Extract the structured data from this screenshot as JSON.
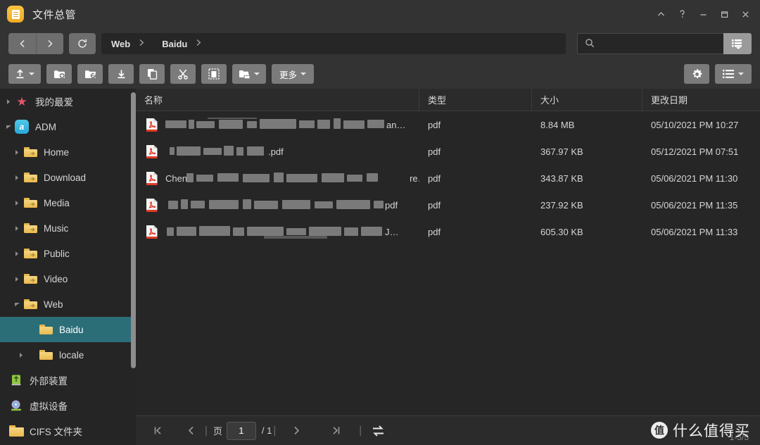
{
  "window": {
    "app_icon": "document-app-icon",
    "title": "文件总管",
    "controls": [
      {
        "name": "collapse-ribbon-button",
        "glyph": "chevron-up-icon"
      },
      {
        "name": "help-button",
        "glyph": "question-mark-icon"
      },
      {
        "name": "minimize-button",
        "glyph": "minimize-icon"
      },
      {
        "name": "maximize-button",
        "glyph": "maximize-icon"
      },
      {
        "name": "close-button",
        "glyph": "close-icon"
      }
    ]
  },
  "navbar": {
    "back_icon": "chevron-left-icon",
    "forward_icon": "chevron-right-icon",
    "refresh_icon": "refresh-icon",
    "breadcrumb": [
      "Web",
      "Baidu"
    ],
    "search": {
      "value": "",
      "placeholder": ""
    },
    "filter_icon": "list-filter-icon"
  },
  "toolbar": {
    "buttons": [
      {
        "name": "upload-button",
        "icon": "upload-icon",
        "label": "",
        "caret": true
      },
      {
        "name": "new-folder-button",
        "icon": "folder-plus-icon",
        "label": "",
        "caret": false
      },
      {
        "name": "new-shared-folder-button",
        "icon": "folder-share-icon",
        "label": "",
        "caret": false
      },
      {
        "name": "download-button",
        "icon": "download-icon",
        "label": "",
        "caret": false
      },
      {
        "name": "copy-button",
        "icon": "copy-icon",
        "label": "",
        "caret": false
      },
      {
        "name": "cut-button",
        "icon": "scissors-icon",
        "label": "",
        "caret": false
      },
      {
        "name": "paste-button",
        "icon": "paste-icon",
        "label": "",
        "caret": false
      },
      {
        "name": "share-button",
        "icon": "network-folder-icon",
        "label": "",
        "caret": true
      },
      {
        "name": "more-button",
        "icon": "",
        "label": "更多",
        "caret": true
      }
    ],
    "settings_icon": "gear-icon",
    "view_mode_icon": "list-view-icon",
    "view_mode_caret": true
  },
  "sidebar": {
    "items": [
      {
        "label": "我的最爱",
        "icon": "star-icon",
        "arrow": "collapsed",
        "indent": 0,
        "selected": false
      },
      {
        "label": "ADM",
        "icon": "adm-icon",
        "arrow": "expanded",
        "indent": 0,
        "selected": false
      },
      {
        "label": "Home",
        "icon": "folder-icon",
        "arrow": "collapsed",
        "indent": 1,
        "selected": false
      },
      {
        "label": "Download",
        "icon": "folder-icon",
        "arrow": "collapsed",
        "indent": 1,
        "selected": false
      },
      {
        "label": "Media",
        "icon": "folder-icon",
        "arrow": "collapsed",
        "indent": 1,
        "selected": false
      },
      {
        "label": "Music",
        "icon": "folder-icon",
        "arrow": "collapsed",
        "indent": 1,
        "selected": false
      },
      {
        "label": "Public",
        "icon": "folder-icon",
        "arrow": "collapsed",
        "indent": 1,
        "selected": false
      },
      {
        "label": "Video",
        "icon": "folder-icon",
        "arrow": "collapsed",
        "indent": 1,
        "selected": false
      },
      {
        "label": "Web",
        "icon": "folder-icon",
        "arrow": "expanded",
        "indent": 1,
        "selected": false
      },
      {
        "label": "Baidu",
        "icon": "folder-icon",
        "arrow": "none",
        "indent": 2,
        "selected": true
      },
      {
        "label": "locale",
        "icon": "folder-icon",
        "arrow": "collapsed",
        "indent": 2,
        "selected": false
      },
      {
        "label": "外部装置",
        "icon": "usb-icon",
        "arrow": "none",
        "indent": 0,
        "selected": false
      },
      {
        "label": "虚拟设备",
        "icon": "disc-icon",
        "arrow": "none",
        "indent": 0,
        "selected": false
      },
      {
        "label": "CIFS 文件夹",
        "icon": "folder-icon",
        "arrow": "none",
        "indent": 0,
        "selected": false
      }
    ]
  },
  "filelist": {
    "columns": [
      "名称",
      "类型",
      "大小",
      "更改日期"
    ],
    "rows": [
      {
        "icon": "pdf-icon",
        "name": "",
        "name_visible_prefix": "",
        "name_visible_suffix": "an…",
        "redacted": true,
        "type": "pdf",
        "size": "8.84 MB",
        "modified": "05/10/2021 PM 10:27"
      },
      {
        "icon": "pdf-icon",
        "name": "",
        "name_visible_prefix": "",
        "name_visible_suffix": ".pdf",
        "redacted": true,
        "type": "pdf",
        "size": "367.97 KB",
        "modified": "05/12/2021 PM 07:51"
      },
      {
        "icon": "pdf-icon",
        "name": "",
        "name_visible_prefix": "Chen",
        "name_visible_suffix": "re…",
        "redacted": true,
        "type": "pdf",
        "size": "343.87 KB",
        "modified": "05/06/2021 PM 11:30"
      },
      {
        "icon": "pdf-icon",
        "name": "",
        "name_visible_prefix": "",
        "name_visible_suffix": "pdf",
        "redacted": true,
        "type": "pdf",
        "size": "237.92 KB",
        "modified": "05/06/2021 PM 11:35"
      },
      {
        "icon": "pdf-icon",
        "name": "",
        "name_visible_prefix": "",
        "name_visible_suffix": "J…",
        "redacted": true,
        "type": "pdf",
        "size": "605.30 KB",
        "modified": "05/06/2021 PM 11:33"
      }
    ]
  },
  "statusbar": {
    "first_page_icon": "first-page-icon",
    "prev_page_icon": "prev-page-icon",
    "page_label": "页",
    "page_value": "1",
    "page_total": "/ 1",
    "next_page_icon": "next-page-icon",
    "last_page_icon": "last-page-icon",
    "refresh_icon": "sync-icon",
    "item_range": "1-5/5"
  },
  "watermark": {
    "badge": "值",
    "text": "什么值得买"
  },
  "colors": {
    "window_bg": "#333333",
    "pane_bg": "#262626",
    "sidebar_bg": "#252525",
    "selection": "#2b6e78",
    "accent_folder": "#eab94d",
    "pdf_red": "#e03a28",
    "toolbar_btn": "#7b7b7b"
  }
}
